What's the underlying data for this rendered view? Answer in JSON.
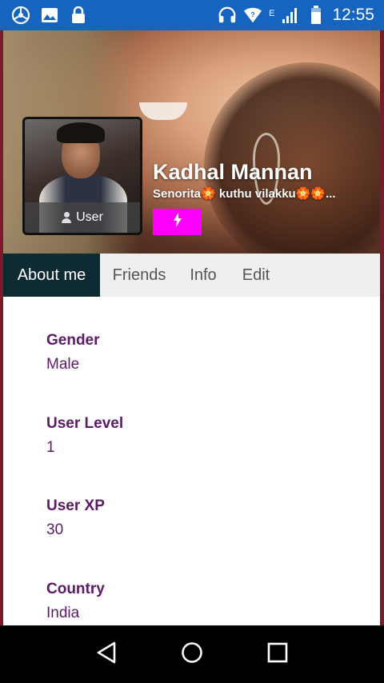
{
  "status_bar": {
    "time": "12:55",
    "network_type": "E",
    "left_icons": [
      "android-system-icon",
      "image-icon",
      "lock-icon"
    ],
    "right_icons": [
      "headset-icon",
      "wifi-icon",
      "signal-icon",
      "battery-icon"
    ],
    "background": "#1565c0"
  },
  "profile": {
    "name": "Kadhal Mannan",
    "status": "Senorita🏵️ kuthu vilakku🏵️🏵️...",
    "avatar_label": "User",
    "badge_icon": "flash-icon",
    "badge_color": "#ff00ff"
  },
  "tabs": [
    {
      "label": "About me",
      "active": true
    },
    {
      "label": "Friends",
      "active": false
    },
    {
      "label": "Info",
      "active": false
    },
    {
      "label": "Edit",
      "active": false
    }
  ],
  "about": {
    "fields": [
      {
        "label": "Gender",
        "value": "Male"
      },
      {
        "label": "User Level",
        "value": "1"
      },
      {
        "label": "User XP",
        "value": "30"
      },
      {
        "label": "Country",
        "value": "India"
      }
    ]
  },
  "nav_bar": {
    "buttons": [
      "back-icon",
      "home-icon",
      "recents-icon"
    ]
  },
  "colors": {
    "accent_text": "#5b1a66",
    "active_tab": "#0e2a33",
    "frame": "#7a1a2a"
  }
}
